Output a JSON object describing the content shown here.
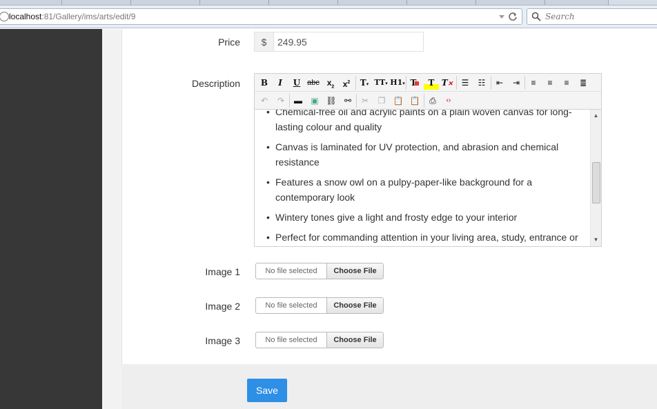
{
  "browser": {
    "url_host": "localhost",
    "url_rest": ":81/Gallery/ims/arts/edit/9",
    "search_placeholder": "Search"
  },
  "form": {
    "price": {
      "label": "Price",
      "currency": "$",
      "value": "249.95"
    },
    "description": {
      "label": "Description",
      "toolbar_row1": [
        "B",
        "I",
        "U",
        "abc",
        "x₂",
        "x²",
        "T",
        "TT",
        "H",
        "T",
        "T",
        "T",
        "list-ul",
        "list-ol",
        "outdent",
        "indent",
        "align-left",
        "align-center",
        "align-right",
        "justify"
      ],
      "items": [
        {
          "text": "Chemical-free oil and acrylic paints on a plain woven canvas for long-lasting colour and quality"
        },
        {
          "text": "Canvas is laminated for UV protection, and abrasion and chemical resistance"
        },
        {
          "text": "Features a snow owl on a pulpy-paper-like background for a contemporary look"
        },
        {
          "text": "Wintery tones give a light and frosty edge to your interior"
        },
        {
          "text": "Perfect for commanding attention in your living area, study, entrance or"
        }
      ]
    },
    "images": [
      {
        "label": "Image 1",
        "status": "No file selected",
        "button": "Choose File"
      },
      {
        "label": "Image 2",
        "status": "No file selected",
        "button": "Choose File"
      },
      {
        "label": "Image 3",
        "status": "No file selected",
        "button": "Choose File"
      }
    ],
    "save_label": "Save"
  },
  "colors": {
    "sidebar": "#373737",
    "save_button": "#2e8fe6",
    "footer": "#eeeeee"
  }
}
